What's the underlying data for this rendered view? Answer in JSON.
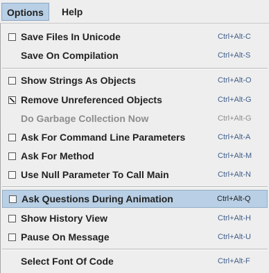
{
  "menubar": {
    "options_label": "Options",
    "help_label": "Help"
  },
  "menu": {
    "items": [
      {
        "label": "Save Files In Unicode",
        "shortcut": "Ctrl+Alt-C",
        "checkbox": true,
        "checked": false,
        "enabled": true
      },
      {
        "label": "Save On Compilation",
        "shortcut": "Ctrl+Alt-S",
        "checkbox": false,
        "enabled": true
      },
      {
        "label": "Show Strings As Objects",
        "shortcut": "Ctrl+Alt-O",
        "checkbox": true,
        "checked": false,
        "enabled": true
      },
      {
        "label": "Remove Unreferenced Objects",
        "shortcut": "Ctrl+Alt-G",
        "checkbox": true,
        "checked": true,
        "enabled": true
      },
      {
        "label": "Do Garbage Collection Now",
        "shortcut": "Ctrl+Alt-G",
        "checkbox": false,
        "enabled": false
      },
      {
        "label": "Ask For Command Line Parameters",
        "shortcut": "Ctrl+Alt-A",
        "checkbox": true,
        "checked": false,
        "enabled": true
      },
      {
        "label": "Ask For Method",
        "shortcut": "Ctrl+Alt-M",
        "checkbox": true,
        "checked": false,
        "enabled": true
      },
      {
        "label": "Use Null Parameter To Call Main",
        "shortcut": "Ctrl+Alt-N",
        "checkbox": true,
        "checked": false,
        "enabled": true
      },
      {
        "label": "Ask Questions During Animation",
        "shortcut": "Ctrl+Alt-Q",
        "checkbox": true,
        "checked": false,
        "enabled": true,
        "highlighted": true
      },
      {
        "label": "Show History View",
        "shortcut": "Ctrl+Alt-H",
        "checkbox": true,
        "checked": false,
        "enabled": true
      },
      {
        "label": "Pause On Message",
        "shortcut": "Ctrl+Alt-U",
        "checkbox": true,
        "checked": false,
        "enabled": true
      },
      {
        "label": "Select Font Of Code",
        "shortcut": "Ctrl+Alt-F",
        "checkbox": false,
        "enabled": true
      }
    ]
  }
}
